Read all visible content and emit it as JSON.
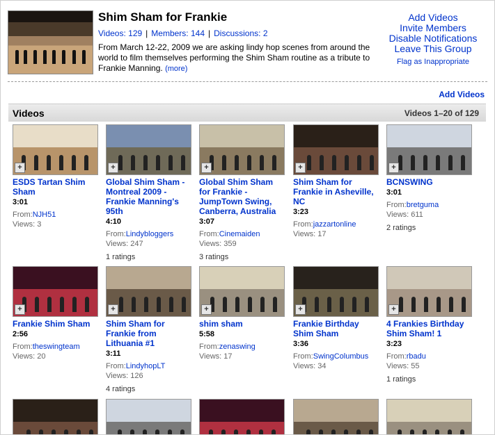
{
  "group": {
    "title": "Shim Sham for Frankie",
    "videos_stat": "Videos: 129",
    "members_stat": "Members: 144",
    "discussions_stat": "Discussions: 2",
    "description": "From March 12-22, 2009 we are asking lindy hop scenes from around the world to film themselves performing the Shim Sham routine as a tribute to Frankie Manning.",
    "more_label": "(more)"
  },
  "actions": {
    "add_videos": "Add Videos",
    "invite_members": "Invite Members",
    "disable_notifications": "Disable Notifications",
    "leave_group": "Leave This Group",
    "flag": "Flag as Inappropriate"
  },
  "add_videos_link": "Add Videos",
  "section": {
    "title": "Videos",
    "range": "Videos 1–20 of 129"
  },
  "labels": {
    "from": "From:",
    "views": "Views:"
  },
  "videos": [
    {
      "title": "ESDS Tartan Shim Sham",
      "duration": "3:01",
      "from": "NJH51",
      "views": "3",
      "ratings": ""
    },
    {
      "title": "Global Shim Sham - Montreal 2009 - Frankie Manning's 95th",
      "duration": "4:10",
      "from": "Lindybloggers",
      "views": "247",
      "ratings": "1 ratings"
    },
    {
      "title": "Global Shim Sham for Frankie - JumpTown Swing, Canberra, Australia",
      "duration": "3:07",
      "from": "Cinemaiden",
      "views": "359",
      "ratings": "3 ratings"
    },
    {
      "title": "Shim Sham for Frankie in Asheville, NC",
      "duration": "3:23",
      "from": "jazzartonline",
      "views": "17",
      "ratings": ""
    },
    {
      "title": "BCNSWING",
      "duration": "3:01",
      "from": "bretguma",
      "views": "611",
      "ratings": "2 ratings"
    },
    {
      "title": "Frankie Shim Sham",
      "duration": "2:56",
      "from": "theswingteam",
      "views": "20",
      "ratings": ""
    },
    {
      "title": "Shim Sham for Frankie from Lithuania #1",
      "duration": "3:11",
      "from": "LindyhopLT",
      "views": "126",
      "ratings": "4 ratings"
    },
    {
      "title": "shim sham",
      "duration": "5:58",
      "from": "zenaswing",
      "views": "17",
      "ratings": ""
    },
    {
      "title": "Frankie Birthday Shim Sham",
      "duration": "3:36",
      "from": "SwingColumbus",
      "views": "34",
      "ratings": ""
    },
    {
      "title": "4 Frankies Birthday Shim Sham! 1",
      "duration": "3:23",
      "from": "rbadu",
      "views": "55",
      "ratings": "1 ratings"
    }
  ]
}
